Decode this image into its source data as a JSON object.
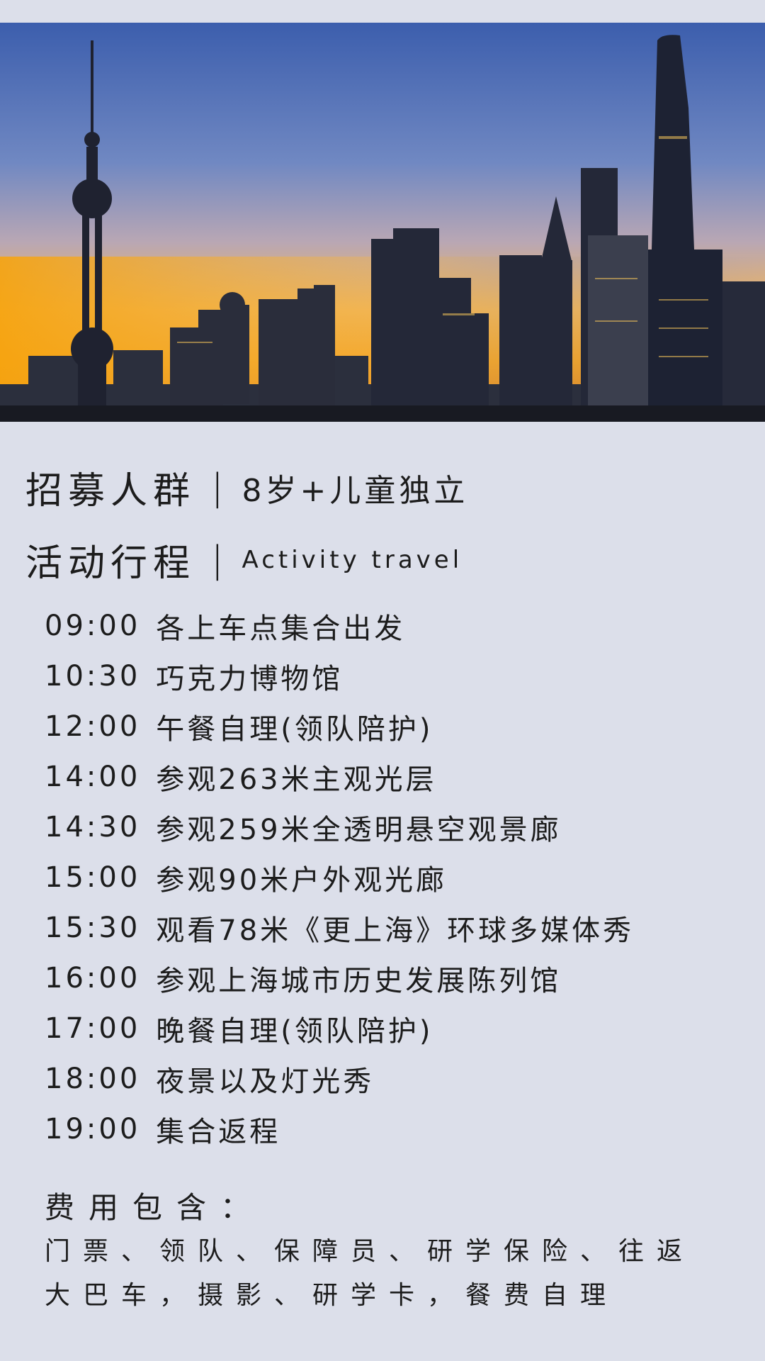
{
  "recruit": {
    "label": "招募人群",
    "separator": "|",
    "value": "8岁+儿童独立"
  },
  "itinerary": {
    "label": "活动行程",
    "separator": "|",
    "subtitle": "Activity travel",
    "items": [
      {
        "time": "09:00",
        "activity": "各上车点集合出发"
      },
      {
        "time": "10:30",
        "activity": "巧克力博物馆"
      },
      {
        "time": "12:00",
        "activity": "午餐自理(领队陪护)"
      },
      {
        "time": "14:00",
        "activity": "参观263米主观光层"
      },
      {
        "time": "14:30",
        "activity": "参观259米全透明悬空观景廊"
      },
      {
        "time": "15:00",
        "activity": "参观90米户外观光廊"
      },
      {
        "time": "15:30",
        "activity": "观看78米《更上海》环球多媒体秀"
      },
      {
        "time": "16:00",
        "activity": "参观上海城市历史发展陈列馆"
      },
      {
        "time": "17:00",
        "activity": "晚餐自理(领队陪护)"
      },
      {
        "time": "18:00",
        "activity": "夜景以及灯光秀"
      },
      {
        "time": "19:00",
        "activity": "集合返程"
      }
    ]
  },
  "fees": {
    "title": "费用包含：",
    "body": "门票、领队、保障员、研学保险、往返大巴车，摄影、研学卡，餐费自理"
  },
  "colors": {
    "background": "#dcdfea",
    "text": "#1c1c1c",
    "sky_top": "#3f5fb0",
    "sky_horizon": "#f2a12c"
  },
  "hero": {
    "icon": "shanghai-skyline-photo"
  }
}
